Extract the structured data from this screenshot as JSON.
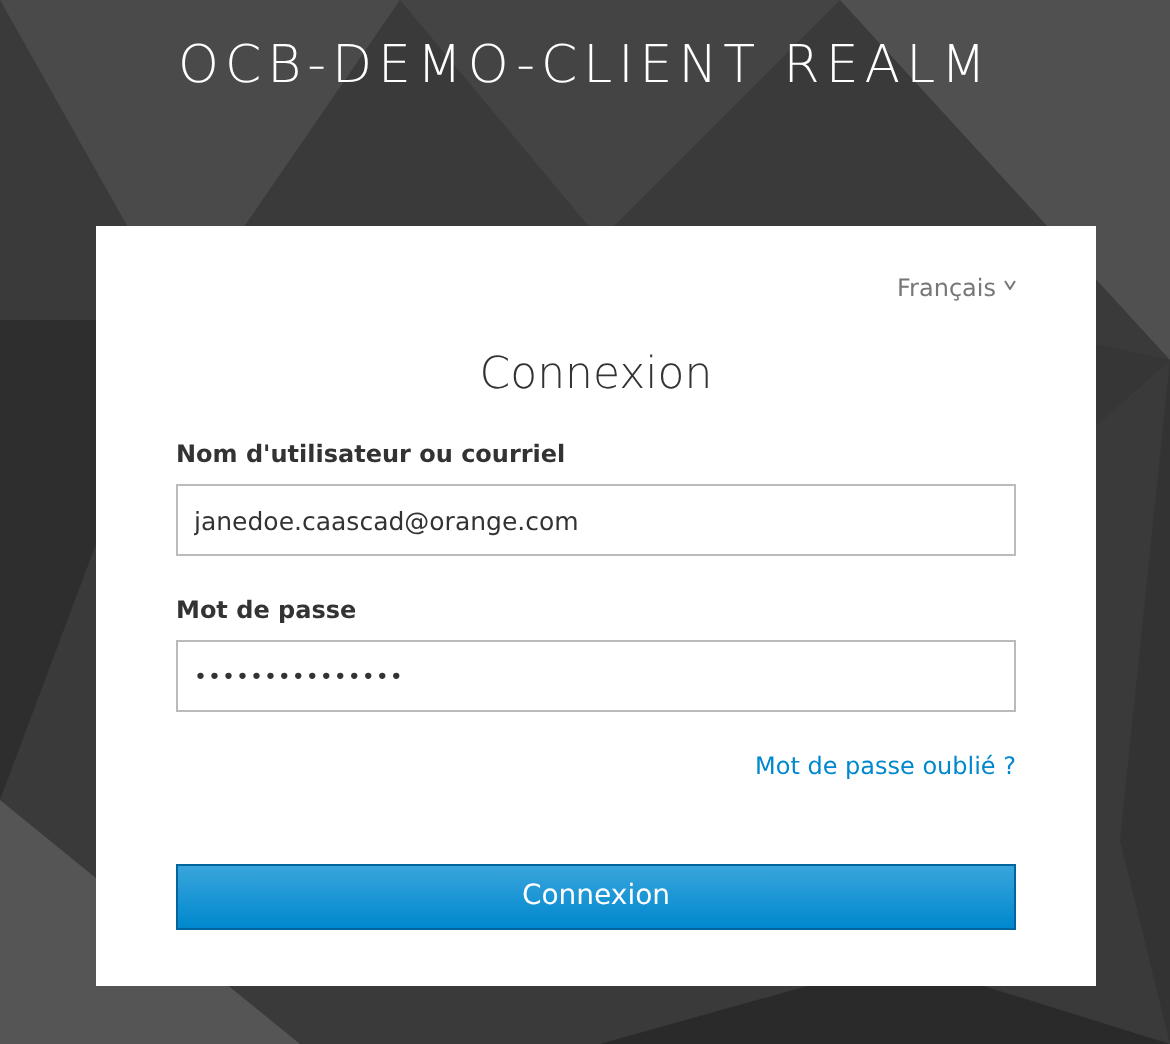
{
  "realm_title": "OCB-DEMO-CLIENT REALM",
  "language": {
    "label": "Français"
  },
  "heading": "Connexion",
  "fields": [
    {
      "label": "Nom d'utilisateur ou courriel",
      "value": "janedoe.caascad@orange.com"
    },
    {
      "label": "Mot de passe",
      "value": "•••••••••••••••"
    }
  ],
  "forgot_link": "Mot de passe oublié ?",
  "submit_button": "Connexion"
}
